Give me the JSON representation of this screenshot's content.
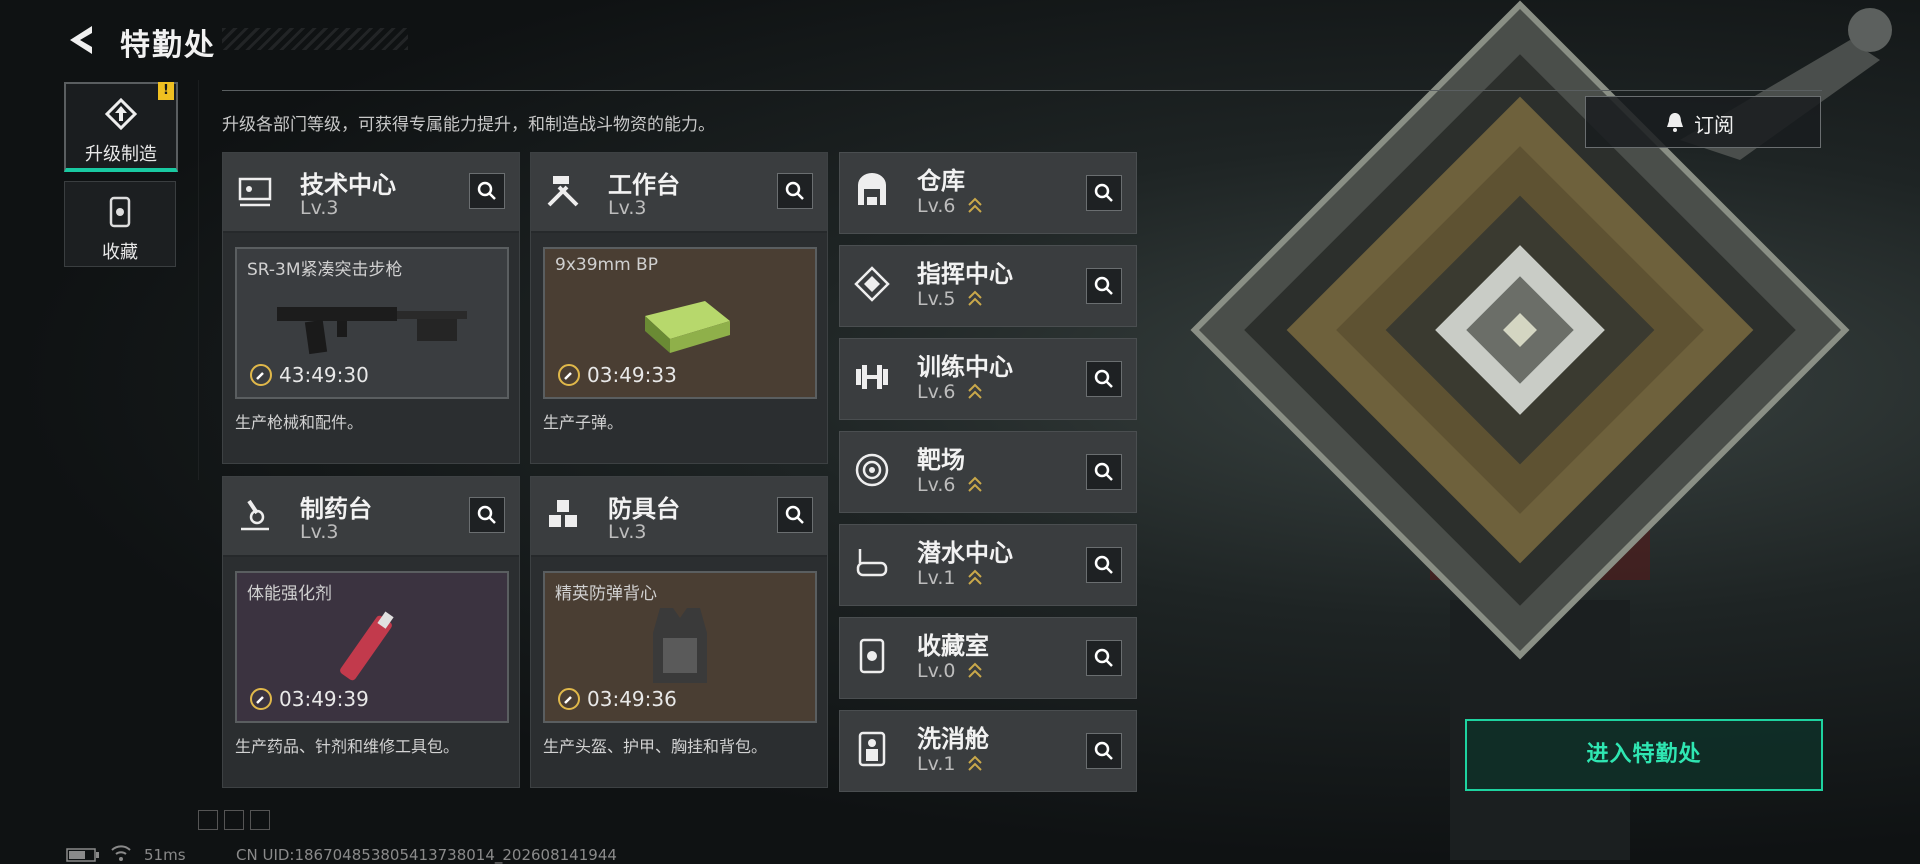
{
  "header": {
    "title": "特勤处"
  },
  "nav": [
    {
      "label": "升级制造",
      "active": true,
      "badge": "!"
    },
    {
      "label": "收藏",
      "active": false
    }
  ],
  "description": "升级各部门等级，可获得专属能力提升，和制造战斗物资的能力。",
  "cards": [
    {
      "name": "技术中心",
      "level": "Lv.3",
      "product": "SR-3M紧凑突击步枪",
      "timer": "43:49:30",
      "footer": "生产枪械和配件。",
      "bg": "#3a3d40"
    },
    {
      "name": "工作台",
      "level": "Lv.3",
      "product": "9x39mm BP",
      "timer": "03:49:33",
      "footer": "生产子弹。",
      "bg": "#4a3e33"
    },
    {
      "name": "制药台",
      "level": "Lv.3",
      "product": "体能强化剂",
      "timer": "03:49:39",
      "footer": "生产药品、针剂和维修工具包。",
      "bg": "#3b3340"
    },
    {
      "name": "防具台",
      "level": "Lv.3",
      "product": "精英防弹背心",
      "timer": "03:49:36",
      "footer": "生产头盔、护甲、胸挂和背包。",
      "bg": "#4a3e33"
    }
  ],
  "departments": [
    {
      "name": "仓库",
      "level": "Lv.6",
      "icon": "warehouse-icon"
    },
    {
      "name": "指挥中心",
      "level": "Lv.5",
      "icon": "command-icon"
    },
    {
      "name": "训练中心",
      "level": "Lv.6",
      "icon": "dumbbell-icon"
    },
    {
      "name": "靶场",
      "level": "Lv.6",
      "icon": "target-icon"
    },
    {
      "name": "潜水中心",
      "level": "Lv.1",
      "icon": "dive-mask-icon"
    },
    {
      "name": "收藏室",
      "level": "Lv.0",
      "icon": "collection-icon"
    },
    {
      "name": "洗消舱",
      "level": "Lv.1",
      "icon": "decontamination-icon"
    }
  ],
  "subscribe_label": "订阅",
  "enter_label": "进入特勤处",
  "status": {
    "ping": "51ms",
    "uid": "CN UID:186704853805413738014_202608141944"
  },
  "colors": {
    "accent": "#1ed3a0",
    "warn": "#f0c021",
    "level_chevron": "#c9a84a"
  }
}
